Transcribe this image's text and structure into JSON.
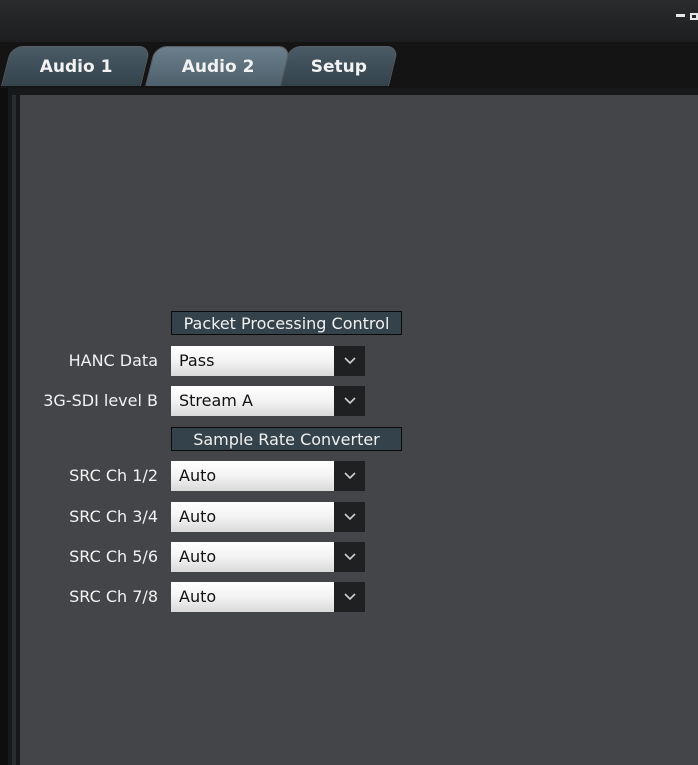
{
  "tabs": [
    {
      "label": "Audio 1"
    },
    {
      "label": "Audio 2"
    },
    {
      "label": "Setup"
    }
  ],
  "sections": {
    "packet": {
      "title": "Packet Processing Control"
    },
    "src": {
      "title": "Sample Rate Converter"
    }
  },
  "rows": {
    "hanc": {
      "label": "HANC Data",
      "value": "Pass"
    },
    "sdi": {
      "label": "3G-SDI level B",
      "value": "Stream A"
    },
    "src12": {
      "label": "SRC Ch 1/2",
      "value": "Auto"
    },
    "src34": {
      "label": "SRC Ch 3/4",
      "value": "Auto"
    },
    "src56": {
      "label": "SRC Ch 5/6",
      "value": "Auto"
    },
    "src78": {
      "label": "SRC Ch 7/8",
      "value": "Auto"
    }
  },
  "icons": {
    "minimize": "minimize-icon",
    "maximize": "maximize-icon",
    "dropdown": "chevron-down-icon"
  },
  "colors": {
    "panel": "#434548",
    "section_header": "#33424b",
    "active_tab": "#6b7f8c",
    "inactive_tab": "#4a5b66"
  }
}
